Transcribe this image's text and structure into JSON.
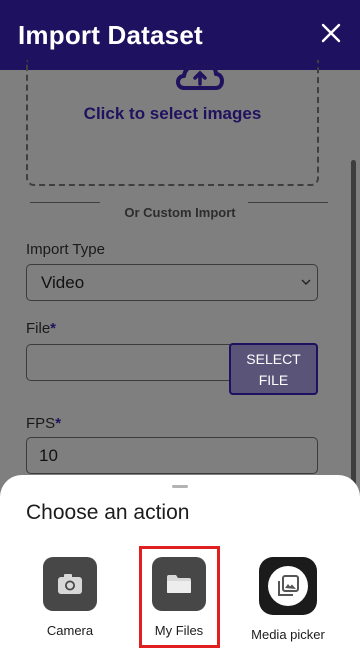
{
  "header": {
    "title": "Import Dataset",
    "close_icon": "close-icon"
  },
  "upload": {
    "text": "Click to select images",
    "icon": "cloud-upload-icon"
  },
  "divider": {
    "label": "Or Custom Import"
  },
  "import_type": {
    "label": "Import Type",
    "value": "Video"
  },
  "file": {
    "label": "File",
    "required": "*",
    "value": "",
    "button_line1": "SELECT",
    "button_line2": "FILE"
  },
  "fps": {
    "label": "FPS",
    "required": "*",
    "value": "10"
  },
  "sheet": {
    "title": "Choose an action",
    "actions": [
      {
        "label": "Camera",
        "icon": "camera-icon"
      },
      {
        "label": "My Files",
        "icon": "folder-icon"
      },
      {
        "label": "Media picker",
        "icon": "gallery-icon"
      }
    ]
  },
  "colors": {
    "header_bg": "#1e1160",
    "accent": "#20125e",
    "highlight": "#e02020"
  }
}
